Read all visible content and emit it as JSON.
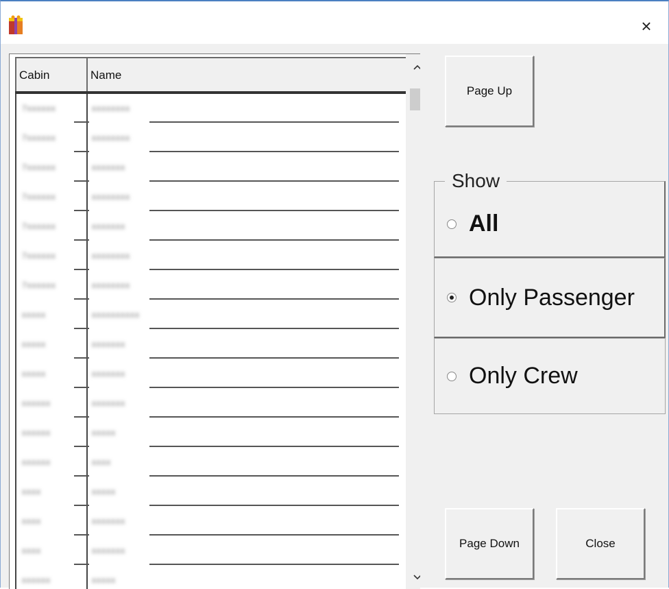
{
  "window": {
    "close_glyph": "×",
    "app_icon": "app-icon"
  },
  "grid": {
    "columns": [
      {
        "label": "Cabin"
      },
      {
        "label": "Name"
      }
    ],
    "rows": [
      {
        "cabin": "7xxxxxx",
        "name": "xxxxxxxx"
      },
      {
        "cabin": "7xxxxxx",
        "name": "xxxxxxxx"
      },
      {
        "cabin": "7xxxxxx",
        "name": "xxxxxxx"
      },
      {
        "cabin": "7xxxxxx",
        "name": "xxxxxxxx"
      },
      {
        "cabin": "7xxxxxx",
        "name": "xxxxxxx"
      },
      {
        "cabin": "7xxxxxx",
        "name": "xxxxxxxx"
      },
      {
        "cabin": "7xxxxxx",
        "name": "xxxxxxxx"
      },
      {
        "cabin": "xxxxx",
        "name": "xxxxxxxxxx"
      },
      {
        "cabin": "xxxxx",
        "name": "xxxxxxx"
      },
      {
        "cabin": "xxxxx",
        "name": "xxxxxxx"
      },
      {
        "cabin": "xxxxxx",
        "name": "xxxxxxx"
      },
      {
        "cabin": "xxxxxx",
        "name": "xxxxx"
      },
      {
        "cabin": "xxxxxx",
        "name": "xxxx"
      },
      {
        "cabin": "xxxx",
        "name": "xxxxx"
      },
      {
        "cabin": "xxxx",
        "name": "xxxxxxx"
      },
      {
        "cabin": "xxxx",
        "name": "xxxxxxx"
      },
      {
        "cabin": "xxxxxx",
        "name": "xxxxx"
      }
    ],
    "scroll_up_glyph": "^",
    "scroll_down_glyph": "v"
  },
  "buttons": {
    "page_up": "Page Up",
    "page_down": "Page Down",
    "close": "Close"
  },
  "show": {
    "legend": "Show",
    "options": [
      {
        "label": "All",
        "checked": false
      },
      {
        "label": "Only Passenger",
        "checked": true
      },
      {
        "label": "Only Crew",
        "checked": false
      }
    ]
  }
}
